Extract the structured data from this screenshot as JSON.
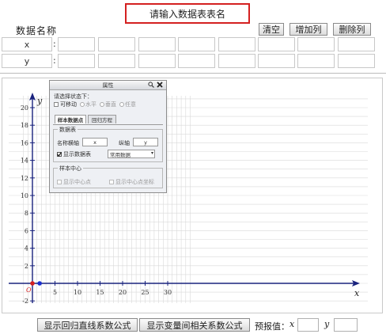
{
  "header": {
    "table_name_placeholder": "请输入数据表表名",
    "data_name_label": "数据名称",
    "buttons": {
      "clear": "清空",
      "add_column": "增加列",
      "delete_column": "删除列"
    }
  },
  "table": {
    "rows": [
      {
        "label": "x",
        "colon": ":",
        "cells": [
          "",
          "",
          "",
          "",
          "",
          "",
          "",
          ""
        ]
      },
      {
        "label": "y",
        "colon": ":",
        "cells": [
          "",
          "",
          "",
          "",
          "",
          "",
          "",
          ""
        ]
      }
    ]
  },
  "graph": {
    "x_axis_label": "x",
    "y_axis_label": "y",
    "origin_label": "O",
    "x_ticks": [
      "5",
      "10",
      "15",
      "20",
      "25",
      "30"
    ],
    "y_ticks": [
      "20",
      "18",
      "16",
      "14",
      "12",
      "10",
      "8",
      "6",
      "4",
      "2",
      "-2"
    ],
    "points": [
      {
        "color": "#d42020"
      },
      {
        "color": "#1a2fd0"
      }
    ]
  },
  "dialog": {
    "title": "属性",
    "search_icon": "magnifier-icon",
    "close_icon": "close-icon",
    "instruction": "请选择状态下：",
    "movable_label": "可移动",
    "radio_options": [
      "水平",
      "垂直",
      "任意"
    ],
    "tabs": [
      "样本数据点",
      "回归方程"
    ],
    "data_table_group": "数据表",
    "name_label": "名称:",
    "horizontal_axis_label": "横轴",
    "horizontal_axis_value": "x",
    "vertical_axis_label": "纵轴",
    "vertical_axis_value": "y",
    "show_table_label": "显示数据表",
    "data_type_selected": "常用数据",
    "sample_center_group": "样本中心",
    "show_center_point": "显示中心点",
    "show_center_coords": "显示中心点坐标"
  },
  "footer": {
    "show_regression_formula": "显示回归直线系数公式",
    "show_correlation_formula": "显示变量间相关系数公式",
    "predict_label": "预报值：",
    "predict_x_label": "x",
    "predict_y_label": "y",
    "predict_x_value": "",
    "predict_y_value": ""
  },
  "colors": {
    "accent_border": "#d42020",
    "axis": "#1a237e",
    "grid": "#d9d9d9"
  }
}
